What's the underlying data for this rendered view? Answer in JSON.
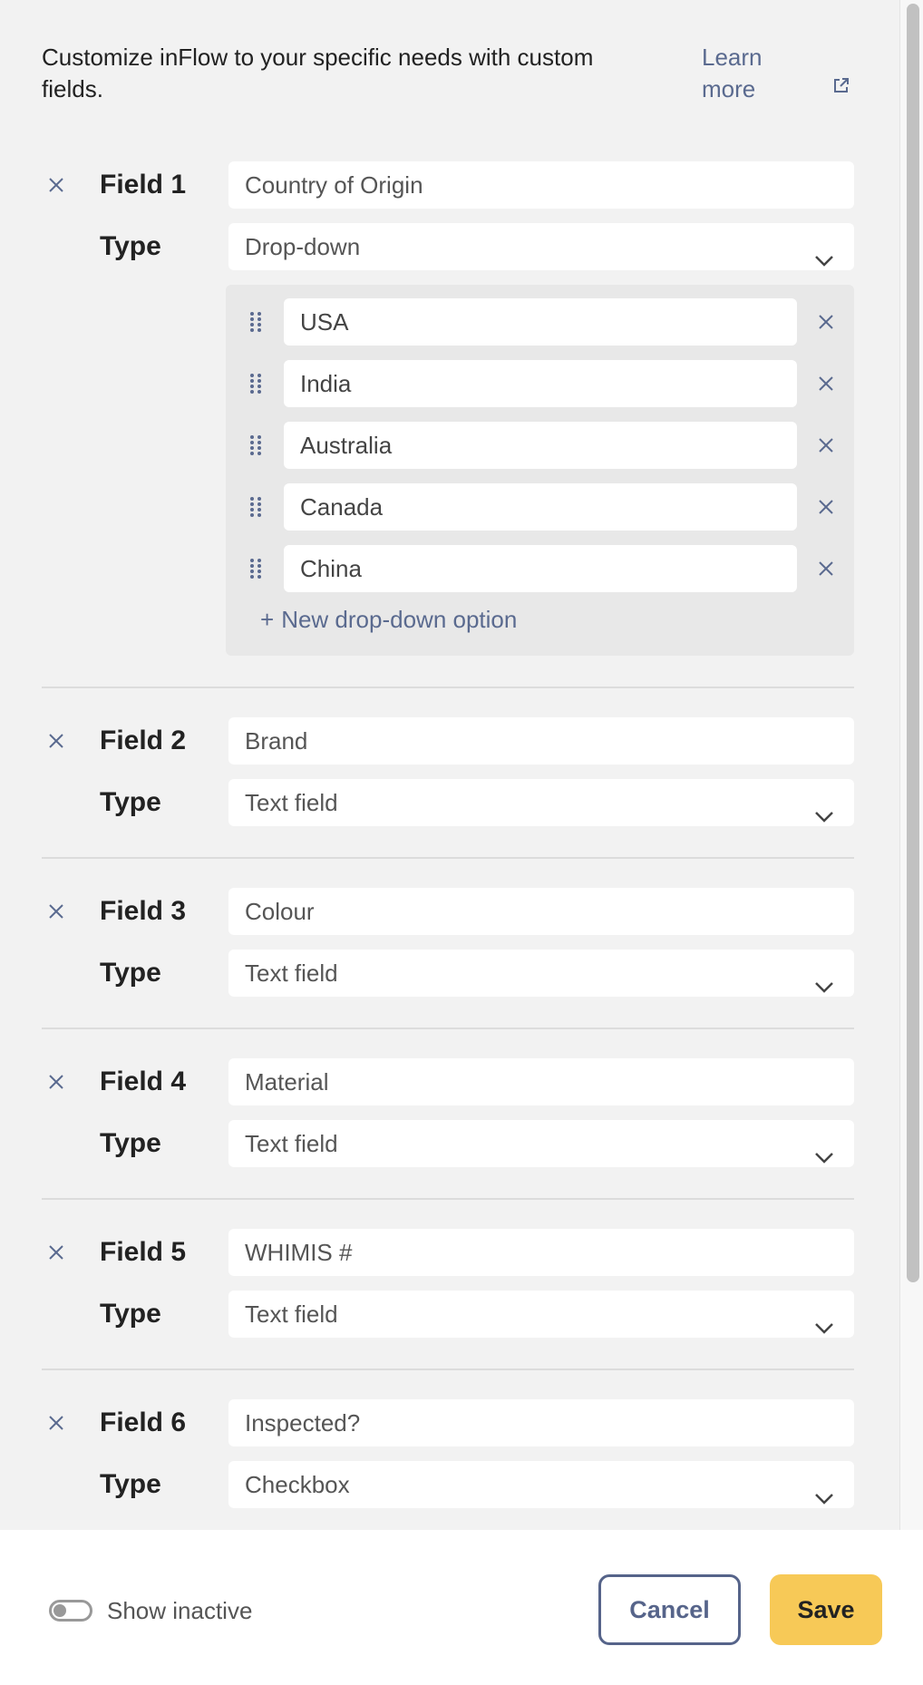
{
  "intro": {
    "text": "Customize inFlow to your specific needs with custom fields.",
    "learn_more": "Learn more",
    "learn_more_icon": "external-link-icon"
  },
  "fields": [
    {
      "label": "Field 1",
      "name": "Country of Origin",
      "type_label": "Type",
      "type": "Drop-down",
      "options": [
        "USA",
        "India",
        "Australia",
        "Canada",
        "China"
      ],
      "new_option_label": "New drop-down option"
    },
    {
      "label": "Field 2",
      "name": "Brand",
      "type_label": "Type",
      "type": "Text field"
    },
    {
      "label": "Field 3",
      "name": "Colour",
      "type_label": "Type",
      "type": "Text field"
    },
    {
      "label": "Field 4",
      "name": "Material",
      "type_label": "Type",
      "type": "Text field"
    },
    {
      "label": "Field 5",
      "name": "WHIMIS #",
      "type_label": "Type",
      "type": "Text field"
    },
    {
      "label": "Field 6",
      "name": "Inspected?",
      "type_label": "Type",
      "type": "Checkbox"
    }
  ],
  "footer": {
    "show_inactive_label": "Show inactive",
    "show_inactive_on": false,
    "cancel_label": "Cancel",
    "save_label": "Save"
  },
  "colors": {
    "accent": "#56648a",
    "save": "#f7c957",
    "background": "#f2f2f2"
  }
}
